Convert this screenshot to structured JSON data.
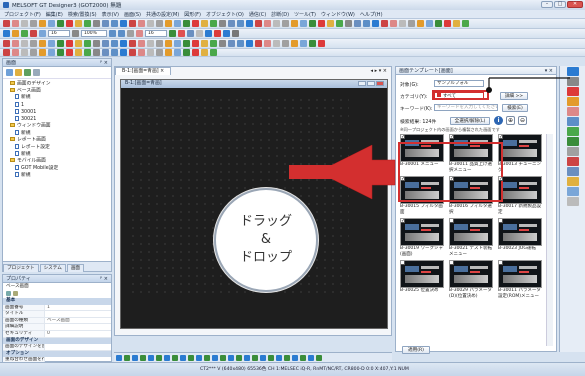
{
  "window": {
    "title": "MELSOFT GT Designer3 (GOT2000) 無題"
  },
  "menu": [
    "プロジェクト(F)",
    "編集(E)",
    "検索/置換(S)",
    "表示(V)",
    "画面(S)",
    "共通の設定(M)",
    "図形(F)",
    "オブジェクト(O)",
    "通信(C)",
    "診断(D)",
    "ツール(T)",
    "ウィンドウ(W)",
    "ヘルプ(H)"
  ],
  "toolbar2": {
    "font_size": "16",
    "zoom": "100%",
    "font_size2": "16"
  },
  "left_top_panel": {
    "title": "画面",
    "tree": [
      {
        "label": "画面のデザイン",
        "indent": 1,
        "kind": "folder"
      },
      {
        "label": "ベース画面",
        "indent": 1,
        "kind": "folder"
      },
      {
        "label": "新規",
        "indent": 2,
        "kind": "screen"
      },
      {
        "label": "1",
        "indent": 2,
        "kind": "screen"
      },
      {
        "label": "30001",
        "indent": 2,
        "kind": "screen"
      },
      {
        "label": "30021",
        "indent": 2,
        "kind": "screen"
      },
      {
        "label": "ウィンドウ画面",
        "indent": 1,
        "kind": "folder"
      },
      {
        "label": "新規",
        "indent": 2,
        "kind": "screen"
      },
      {
        "label": "レポート画面",
        "indent": 1,
        "kind": "folder"
      },
      {
        "label": "レポート設定",
        "indent": 2,
        "kind": "screen"
      },
      {
        "label": "新規",
        "indent": 2,
        "kind": "screen"
      },
      {
        "label": "モバイル画面",
        "indent": 1,
        "kind": "folder"
      },
      {
        "label": "GOT Mobile設定",
        "indent": 2,
        "kind": "screen"
      },
      {
        "label": "新規",
        "indent": 2,
        "kind": "screen"
      }
    ],
    "tabs": [
      "プロジェクト",
      "システム",
      "画面"
    ]
  },
  "properties": {
    "title": "プロパティ",
    "screen_label": "ベース画面",
    "rows": [
      {
        "type": "sec",
        "k": "基本"
      },
      {
        "type": "row",
        "k": "画面番号",
        "v": "1"
      },
      {
        "type": "row",
        "k": "タイトル",
        "v": ""
      },
      {
        "type": "row",
        "k": "画面の種類",
        "v": "ベース画面"
      },
      {
        "type": "row",
        "k": "詳細説明",
        "v": ""
      },
      {
        "type": "row",
        "k": "セキュリティ",
        "v": "0"
      },
      {
        "type": "sec",
        "k": "画面のデザイン"
      },
      {
        "type": "row",
        "k": "画面のデザインを反映しない",
        "v": ""
      },
      {
        "type": "sec",
        "k": "オプション"
      },
      {
        "type": "row",
        "k": "重ね合わせ画面を行わない",
        "v": ""
      },
      {
        "type": "row",
        "k": "バックアップ回路",
        "v": ""
      }
    ]
  },
  "canvas": {
    "tab_label": "B-1:[画面=青画]",
    "screen_caption": "B-1:[画面=青画]"
  },
  "library": {
    "title": "画面テンプレート[画面]",
    "target_label": "対象(G):",
    "target_value": "サンプルフォル",
    "category_label": "カテゴリ(Y):",
    "category_value": "すべて",
    "detail_button": "詳細 >>",
    "keyword_label": "キーワード(K):",
    "keyword_placeholder": "キーワードを入力してください",
    "search_button": "検索(E)",
    "result_label": "検索結果: 124件",
    "select_all_button": "全選択/解除(L)",
    "note": "※同一プロジェクト内の画面から複製された画面です",
    "thumbs": [
      {
        "label": "B-30001 メニュー",
        "checked": true
      },
      {
        "label": "B-30011 品質上げ選択メニュー",
        "checked": true
      },
      {
        "label": "B-30013 チューニング",
        "checked": true
      },
      {
        "label": "B-30015 フィルタ画面",
        "checked": true
      },
      {
        "label": "B-30016 フィルタ選択",
        "checked": true
      },
      {
        "label": "B-30017 新規製品設定",
        "checked": true
      },
      {
        "label": "B-30019 ワークシャ(画面)",
        "checked": true
      },
      {
        "label": "B-30021 テスト装転メニュー",
        "checked": false
      },
      {
        "label": "B-30023 JOG運転",
        "checked": false
      },
      {
        "label": "B-30025 位置決め",
        "checked": false
      },
      {
        "label": "B-30029 パラメータ(D)(位置決め)",
        "checked": false
      },
      {
        "label": "B-30011 パラメータ設定(ROM)メニュー",
        "checked": false
      }
    ],
    "apply_button": "適用(R)"
  },
  "callout": {
    "line1": "ドラッグ",
    "line2": "&",
    "line3": "ドロップ"
  },
  "status": {
    "text": "CT2*** V (640x480) 65536色 CH 1:MELSEC iQ-R, RnMT/NC/RT, CR800-D   0:0   X:407,Y:1   NUM"
  },
  "colors": {
    "accent_red": "#d32f2f",
    "panel_border": "#9db1ca"
  }
}
